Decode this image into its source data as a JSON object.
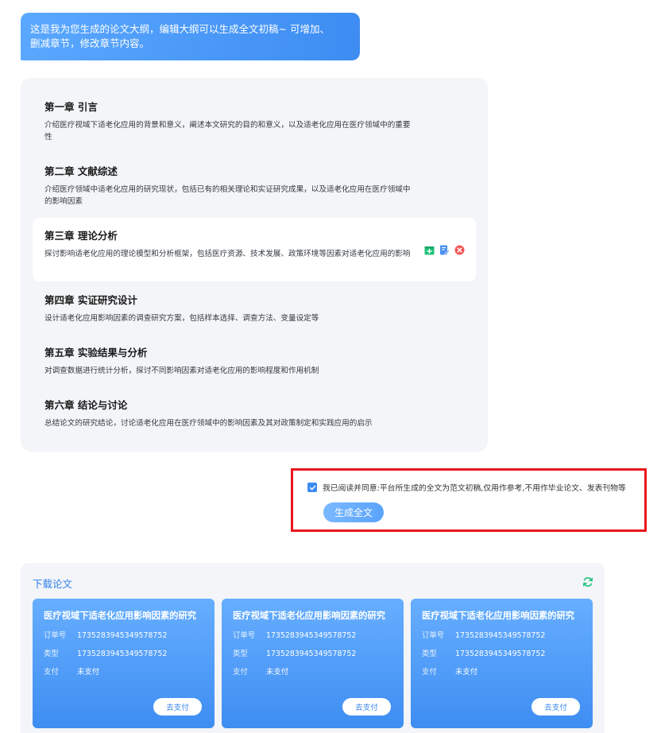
{
  "bubble": {
    "text_line1": "这是我为您生成的论文大纲，编辑大纲可以生成全文初稿~ 可增加、",
    "text_line2": "删减章节，修改章节内容。"
  },
  "outline": {
    "chapters": [
      {
        "title": "第一章 引言",
        "desc": "介绍医疗视域下适老化应用的背景和意义，阐述本文研究的目的和意义，以及适老化应用在医疗领域中的重要性"
      },
      {
        "title": "第二章 文献综述",
        "desc": "介绍医疗领域中适老化应用的研究现状，包括已有的相关理论和实证研究成果，以及适老化应用在医疗领域中的影响因素"
      },
      {
        "title": "第三章 理论分析",
        "desc": "探讨影响适老化应用的理论模型和分析框架，包括医疗资源、技术发展、政策环境等因素对适老化应用的影响"
      },
      {
        "title": "第四章 实证研究设计",
        "desc": "设计适老化应用影响因素的调查研究方案，包括样本选择、调查方法、变量设定等"
      },
      {
        "title": "第五章 实验结果与分析",
        "desc": "对调查数据进行统计分析，探讨不同影响因素对适老化应用的影响程度和作用机制"
      },
      {
        "title": "第六章 结论与讨论",
        "desc": "总结论文的研究结论，讨论适老化应用在医疗领域中的影响因素及其对政策制定和实践应用的启示"
      }
    ],
    "active_index": 2,
    "action_icons": [
      "insert-chapter-icon",
      "edit-icon",
      "delete-icon"
    ]
  },
  "agreement": {
    "checked": true,
    "text": "我已阅读并同意:平台所生成的全文为范文初稿,仅用作参考,不用作毕业论文、发表刊物等",
    "generate_label": "生成全文"
  },
  "download": {
    "title": "下载论文",
    "refresh_icon": "refresh-icon",
    "cards": [
      {
        "title": "医疗视域下适老化应用影响因素的研究",
        "order_label": "订单号",
        "order_no": "1735283945349578752",
        "type_label": "类型",
        "type_value": "1735283945349578752",
        "pay_label": "支付",
        "pay_status": "未支付",
        "pay_button": "去支付"
      },
      {
        "title": "医疗视域下适老化应用影响因素的研究",
        "order_label": "订单号",
        "order_no": "1735283945349578752",
        "type_label": "类型",
        "type_value": "1735283945349578752",
        "pay_label": "支付",
        "pay_status": "未支付",
        "pay_button": "去支付"
      },
      {
        "title": "医疗视域下适老化应用影响因素的研究",
        "order_label": "订单号",
        "order_no": "1735283945349578752",
        "type_label": "类型",
        "type_value": "1735283945349578752",
        "pay_label": "支付",
        "pay_status": "未支付",
        "pay_button": "去支付"
      }
    ]
  },
  "colors": {
    "accent": "#3d8cf2",
    "panel_bg": "#f3f5f8",
    "highlight_border": "#e8171e",
    "refresh_green": "#21c27a",
    "delete_red": "#f25757"
  }
}
